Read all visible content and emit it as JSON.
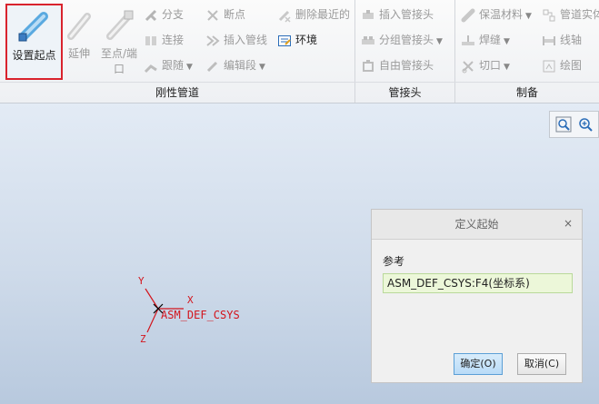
{
  "ribbon": {
    "big_buttons": {
      "set_start": "设置起点",
      "extend": "延伸",
      "to_point_line1": "至点/端",
      "to_point_line2": "口"
    },
    "col1": {
      "branch": "分支",
      "connect": "连接",
      "follow": "跟随"
    },
    "col2": {
      "break_point": "断点",
      "insert_line": "插入管线",
      "edit_segment": "编辑段"
    },
    "col3": {
      "delete_recent": "删除最近的",
      "environment": "环境"
    },
    "fittings": {
      "insert": "插入管接头",
      "group": "分组管接头",
      "free": "自由管接头"
    },
    "mfg": {
      "insulation": "保温材料",
      "weld": "焊缝",
      "cut": "切口",
      "pipe_solid": "管道实体",
      "spool_axis": "线轴",
      "drawing": "绘图"
    },
    "groups": {
      "rigid_pipe": "刚性管道",
      "fitting": "管接头",
      "mfg": "制备"
    }
  },
  "viewport": {
    "csys_name": "ASM_DEF_CSYS",
    "axis_x": "X",
    "axis_y": "Y",
    "axis_z": "Z"
  },
  "dialog": {
    "title": "定义起始",
    "close": "×",
    "reference_label": "参考",
    "reference_value": "ASM_DEF_CSYS:F4(坐标系)",
    "ok_label": "确定(O)",
    "cancel_label": "取消(C)"
  },
  "colors": {
    "highlight": "#d9232d",
    "csys": "#d3141c",
    "field_bg": "#ecf7d9"
  }
}
